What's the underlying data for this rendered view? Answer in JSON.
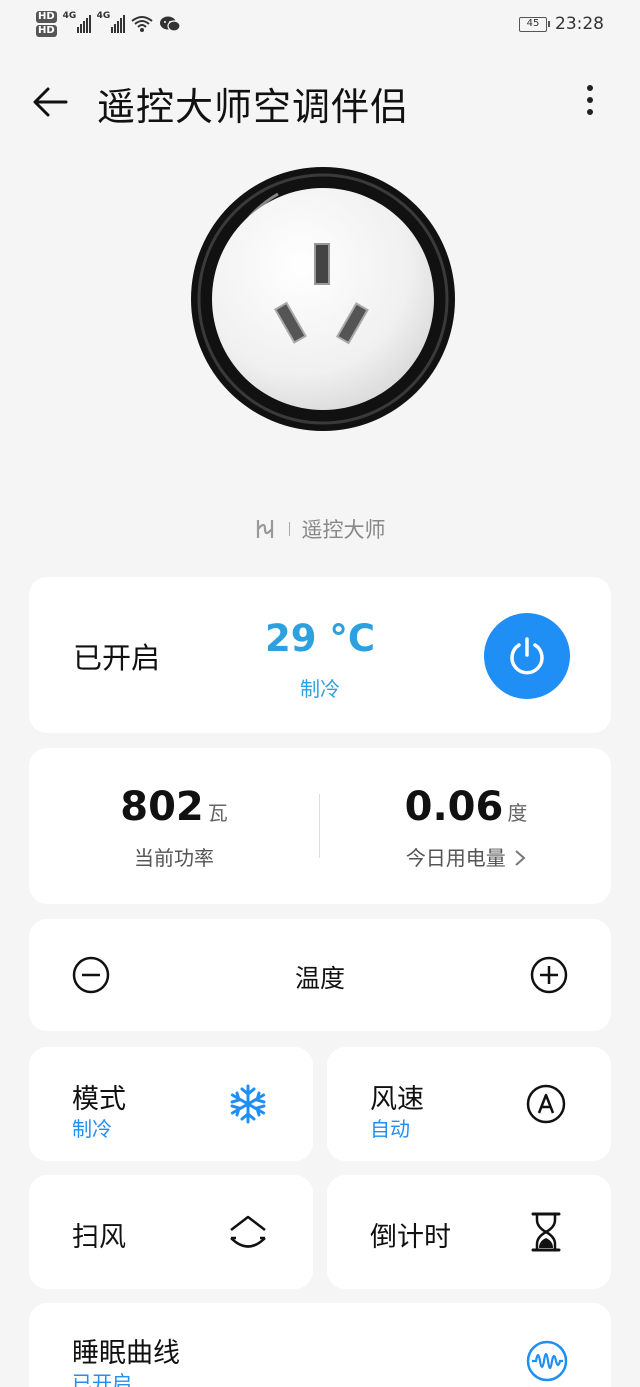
{
  "status_bar": {
    "sim1": "HD",
    "sim2": "HD",
    "net1": "4G",
    "net2": "4G",
    "battery": "45",
    "time": "23:28"
  },
  "header": {
    "title": "遥控大师空调伴侣"
  },
  "brand": {
    "name": "遥控大师"
  },
  "status_card": {
    "state": "已开启",
    "temperature": "29 °C",
    "mode": "制冷"
  },
  "energy": {
    "power_value": "802",
    "power_unit": "瓦",
    "power_label": "当前功率",
    "usage_value": "0.06",
    "usage_unit": "度",
    "usage_label": "今日用电量"
  },
  "temperature_control": {
    "label": "温度"
  },
  "tiles": {
    "mode": {
      "title": "模式",
      "value": "制冷"
    },
    "fan_speed": {
      "title": "风速",
      "value": "自动"
    },
    "swing": {
      "title": "扫风"
    },
    "timer": {
      "title": "倒计时"
    },
    "sleep_curve": {
      "title": "睡眠曲线",
      "value": "已开启"
    }
  },
  "colors": {
    "accent": "#1f8ff5",
    "temperature": "#2ea0df",
    "background": "#f5f5f5"
  }
}
